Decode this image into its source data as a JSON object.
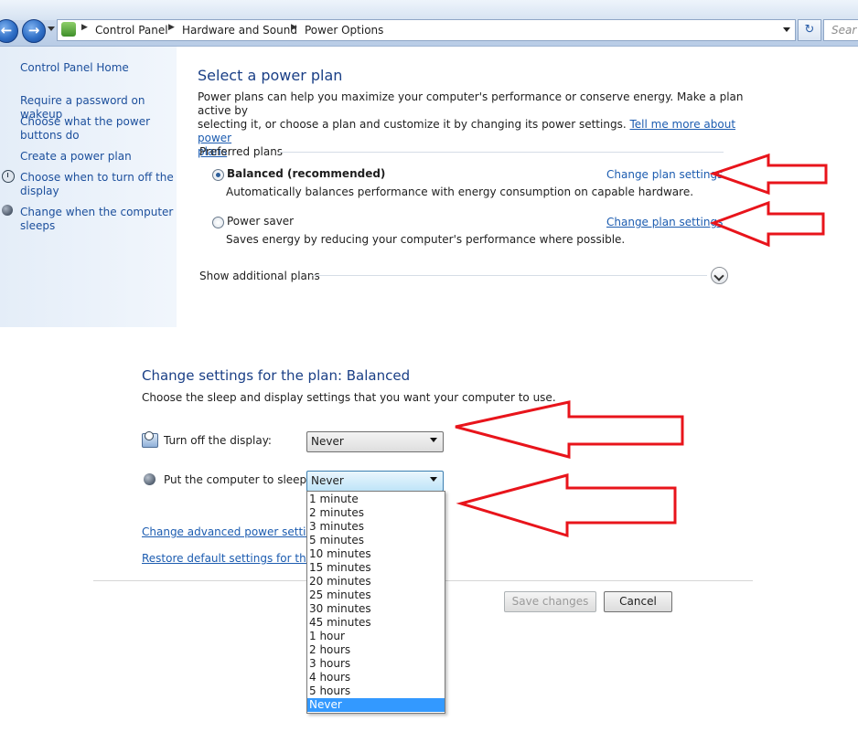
{
  "addressbar": {
    "breadcrumbs": [
      "Control Panel",
      "Hardware and Sound",
      "Power Options"
    ],
    "search_placeholder": "Sear"
  },
  "leftnav": {
    "home": "Control Panel Home",
    "items": [
      {
        "label1": "Require a password on wakeup",
        "label2": ""
      },
      {
        "label1": "Choose what the power",
        "label2": "buttons do"
      },
      {
        "label1": "Create a power plan",
        "label2": ""
      },
      {
        "label1": "Choose when to turn off the",
        "label2": "display"
      },
      {
        "label1": "Change when the computer",
        "label2": "sleeps"
      }
    ]
  },
  "main": {
    "title": "Select a power plan",
    "desc_line1": "Power plans can help you maximize your computer's performance or conserve energy. Make a plan active by",
    "desc_line2": "selecting it, or choose a plan and customize it by changing its power settings.",
    "learn_more1": "Tell me more about power",
    "learn_more2": "plans",
    "preferred_label": "Preferred plans",
    "plans": [
      {
        "name": "Balanced (recommended)",
        "desc": "Automatically balances performance with energy consumption on capable hardware.",
        "link": "Change plan settings",
        "selected": true
      },
      {
        "name": "Power saver",
        "desc": "Saves energy by reducing your computer's performance where possible.",
        "link": "Change plan settings",
        "selected": false
      }
    ],
    "show_additional": "Show additional plans"
  },
  "settings": {
    "title": "Change settings for the plan: Balanced",
    "subtitle": "Choose the sleep and display settings that you want your computer to use.",
    "display_label": "Turn off the display:",
    "display_value": "Never",
    "sleep_label": "Put the computer to sleep:",
    "sleep_value": "Never",
    "sleep_options": [
      "1 minute",
      "2 minutes",
      "3 minutes",
      "5 minutes",
      "10 minutes",
      "15 minutes",
      "20 minutes",
      "25 minutes",
      "30 minutes",
      "45 minutes",
      "1 hour",
      "2 hours",
      "3 hours",
      "4 hours",
      "5 hours",
      "Never"
    ],
    "sleep_selected_index": 15,
    "advanced_link": "Change advanced power settings",
    "restore_link": "Restore default settings for this pla",
    "save_label": "Save changes",
    "cancel_label": "Cancel"
  },
  "annotation": {
    "arrow_color": "#e8141b",
    "selection_color": "#3399ff",
    "link_color": "#1c5cb0"
  }
}
